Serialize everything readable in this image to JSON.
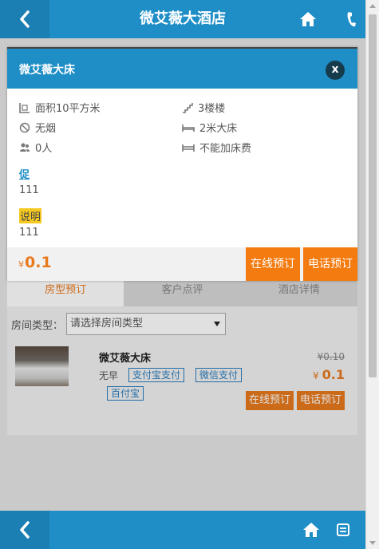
{
  "header": {
    "title": "微艾薇大酒店"
  },
  "page": {
    "tabs": [
      {
        "label": "房型预订"
      },
      {
        "label": "客户点评"
      },
      {
        "label": "酒店详情"
      }
    ],
    "room_type_label": "房间类型：",
    "room_type_select": "请选择房间类型",
    "room": {
      "name": "微艾薇大床",
      "breakfast": "无早",
      "pay_methods": [
        "支付宝支付",
        "微信支付",
        "百付宝"
      ],
      "old_price": "¥0.10",
      "currency": "¥",
      "price": "0.1",
      "book_online": "在线预订",
      "book_phone": "电话预订"
    }
  },
  "modal": {
    "title": "微艾薇大床",
    "close": "x",
    "facts": {
      "area": "面积10平方米",
      "floor": "3楼楼",
      "smoking": "无烟",
      "bed": "2米大床",
      "occupancy": "0人",
      "extra_bed": "不能加床费"
    },
    "promo_tag": "促",
    "promo_value": "111",
    "note_tag": "说明",
    "note_value": "111",
    "currency": "¥",
    "price": "0.1",
    "book_online": "在线预订",
    "book_phone": "电话预订"
  },
  "colors": {
    "brand_blue": "#1f8ec6",
    "accent_orange": "#f47b0f",
    "note_yellow": "#f6c922"
  }
}
